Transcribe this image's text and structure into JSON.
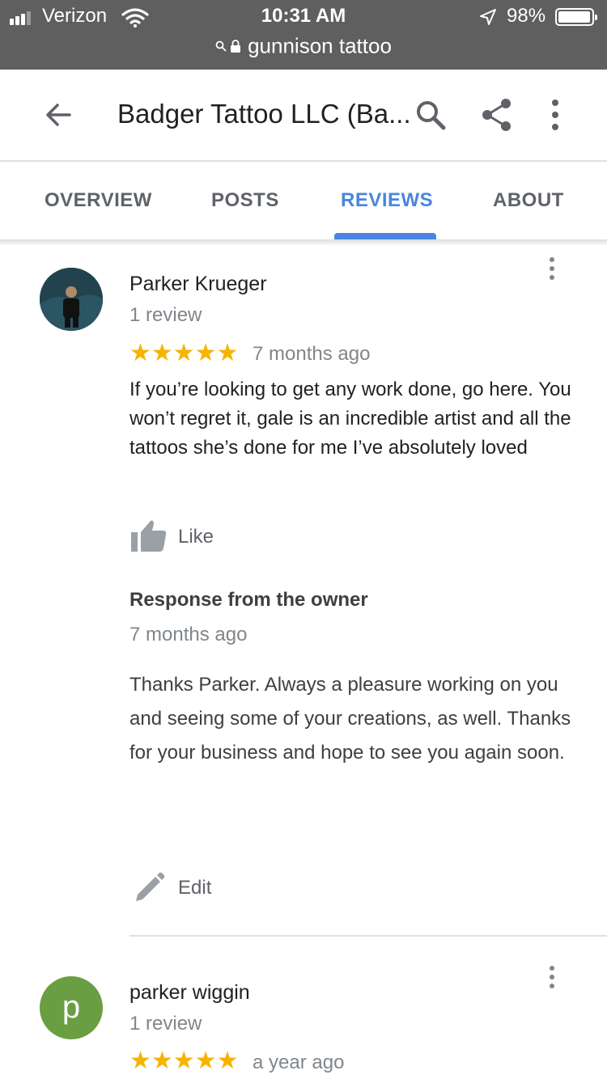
{
  "status_bar": {
    "carrier": "Verizon",
    "time": "10:31 AM",
    "battery_percent_label": "98%",
    "battery_level": 0.98,
    "url": "gunnison tattoo",
    "icons": [
      "signal-icon",
      "wifi-icon",
      "location-arrow-icon",
      "battery-icon",
      "search-icon",
      "lock-icon"
    ]
  },
  "header": {
    "title": "Badger Tattoo LLC (Ba...",
    "icons": [
      "back-arrow-icon",
      "search-icon",
      "share-icon",
      "more-vert-icon"
    ]
  },
  "tabs": [
    {
      "label": "OVERVIEW",
      "active": false
    },
    {
      "label": "POSTS",
      "active": false
    },
    {
      "label": "REVIEWS",
      "active": true
    },
    {
      "label": "ABOUT",
      "active": false
    }
  ],
  "reviews": [
    {
      "name": "Parker Krueger",
      "count": "1 review",
      "stars": "★★★★★",
      "rating": 5,
      "time": "7 months ago",
      "body": "If you’re looking to get any work done, go here. You won’t regret it, gale is an incredible artist and all the tattoos she’s done for me I’ve absolutely loved",
      "like_label": "Like",
      "owner_response": {
        "heading": "Response from the owner",
        "time": "7 months ago",
        "body": "Thanks Parker. Always a pleasure working on you and seeing some of your creations, as well. Thanks for your business and hope to see you again soon."
      },
      "edit_label": "Edit"
    },
    {
      "name": "parker wiggin",
      "avatar_letter": "p",
      "count": "1 review",
      "stars": "★★★★★",
      "rating": 5,
      "time": "a year ago"
    }
  ],
  "colors": {
    "status_bar_bg": "#5f5f5f",
    "accent_blue": "#4a86e0",
    "star_yellow": "#f4b400",
    "avatar_green": "#6a9e42"
  }
}
